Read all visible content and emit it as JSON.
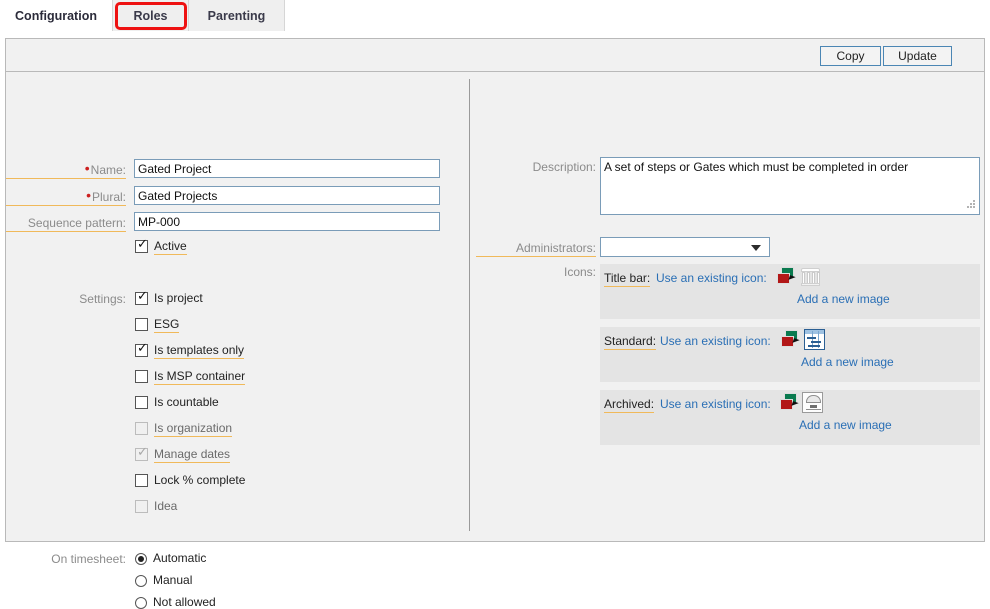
{
  "tabs": [
    {
      "label": "Configuration",
      "active": true
    },
    {
      "label": "Roles",
      "active": false,
      "annotated": true
    },
    {
      "label": "Parenting",
      "active": false
    }
  ],
  "toolbar": {
    "copy_label": "Copy",
    "update_label": "Update"
  },
  "left": {
    "name": {
      "label": "Name:",
      "value": "Gated Project",
      "required": true
    },
    "plural": {
      "label": "Plural:",
      "value": "Gated Projects",
      "required": true
    },
    "sequence_pattern": {
      "label": "Sequence pattern:",
      "value": "MP-000"
    },
    "active": {
      "label": "Active",
      "checked": true
    },
    "settings_label": "Settings:",
    "settings": [
      {
        "label": "Is project",
        "checked": true,
        "disabled": false,
        "underlined": false
      },
      {
        "label": "ESG",
        "checked": false,
        "disabled": false,
        "underlined": true
      },
      {
        "label": "Is templates only",
        "checked": true,
        "disabled": false,
        "underlined": true
      },
      {
        "label": "Is MSP container",
        "checked": false,
        "disabled": false,
        "underlined": true
      },
      {
        "label": "Is countable",
        "checked": false,
        "disabled": false,
        "underlined": false
      },
      {
        "label": "Is organization",
        "checked": false,
        "disabled": true,
        "underlined": true
      },
      {
        "label": "Manage dates",
        "checked": true,
        "disabled": true,
        "underlined": true
      },
      {
        "label": "Lock % complete",
        "checked": false,
        "disabled": false,
        "underlined": false
      },
      {
        "label": "Idea",
        "checked": false,
        "disabled": true,
        "underlined": false
      }
    ],
    "on_timesheet_label": "On timesheet:",
    "on_timesheet": [
      {
        "label": "Automatic",
        "selected": true
      },
      {
        "label": "Manual",
        "selected": false
      },
      {
        "label": "Not allowed",
        "selected": false
      }
    ]
  },
  "right": {
    "description": {
      "label": "Description:",
      "value": "A set of steps or Gates which must be completed in order"
    },
    "administrators": {
      "label": "Administrators:",
      "value": "",
      "options": []
    },
    "icons_label": "Icons:",
    "icon_rows": [
      {
        "label": "Title bar:",
        "link": "Use an existing icon:",
        "add": "Add a new image",
        "picker_icon": "icon-picker-icon",
        "preview_icon": "building-icon"
      },
      {
        "label": "Standard:",
        "link": "Use an existing icon:",
        "add": "Add a new image",
        "picker_icon": "icon-picker-icon",
        "preview_icon": "gantt-grid-icon"
      },
      {
        "label": "Archived:",
        "link": "Use an existing icon:",
        "add": "Add a new image",
        "picker_icon": "icon-picker-icon",
        "preview_icon": "archive-building-icon"
      }
    ]
  },
  "colors": {
    "accent_link": "#2a6fb5",
    "label_underline": "#f0b95a",
    "required_marker": "#cc2020",
    "annotation": "#ee1111",
    "button_border": "#4b86b4",
    "panel_bg": "#f1f1f1",
    "icon_row_bg": "#e4e4e4"
  }
}
